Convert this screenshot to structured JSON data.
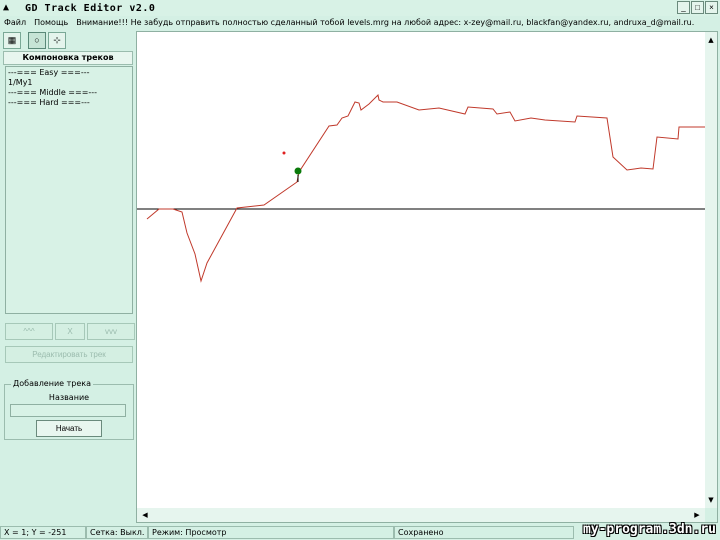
{
  "window": {
    "icon": "app-icon",
    "title": "GD Track Editor v2.0",
    "controls": [
      "minimize-icon",
      "maximize-icon",
      "close-icon"
    ]
  },
  "menu": {
    "file": "Файл",
    "help": "Помощь",
    "notice": "Внимание!!! Не забудь отправить полностью сделанный тобой levels.mrg на любой адрес: x-zey@mail.ru, blackfan@yandex.ru, andruxa_d@mail.ru."
  },
  "toolbar": {
    "grid_icon": "grid-icon",
    "point_icon": "circle-icon",
    "cross_icon": "cross-icon"
  },
  "left_panel": {
    "header": "Компоновка треков",
    "tracks": [
      "---=== Easy ===---",
      "1/My1",
      "---=== Middle ===---",
      "---=== Hard ===---"
    ],
    "up_button": "^^^",
    "delete_button": "X",
    "down_button": "vvv",
    "edit_button": "Редактировать трек",
    "add_group": {
      "title": "Добавление трека",
      "name_label": "Название",
      "name_value": "",
      "start_button": "Начать"
    }
  },
  "canvas": {
    "background": "#ffffff",
    "track_color": "#c0392b",
    "baseline_color": "#000000",
    "start_marker_color": "#0a7a0a"
  },
  "status": {
    "coords": "X = 1;  Y = -251",
    "grid": "Сетка: Выкл.",
    "mode": "Режим: Просмотр",
    "saved": "Сохранено"
  },
  "watermark": "my-program.3dn.ru"
}
